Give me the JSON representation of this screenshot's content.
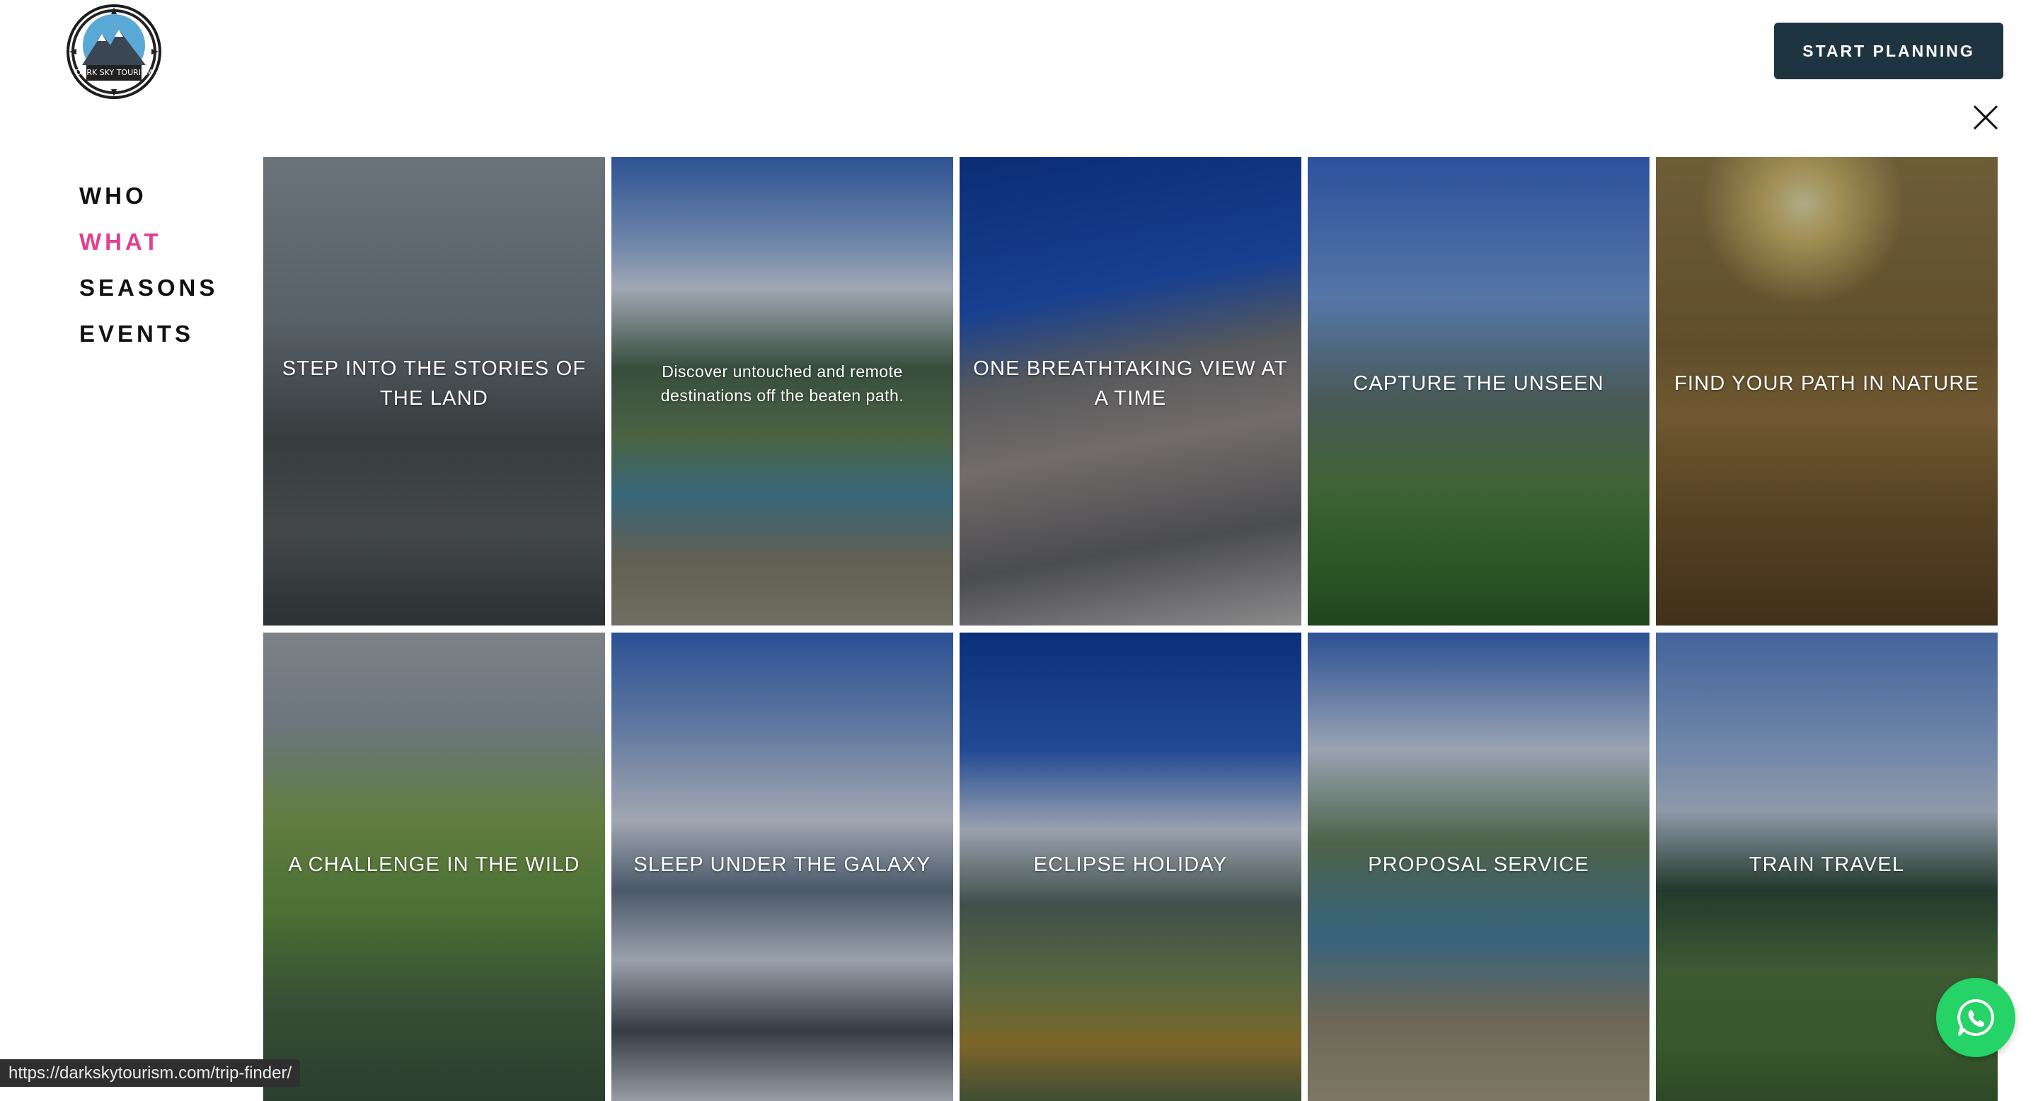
{
  "header": {
    "logo_text": "DARK SKY TOURISM",
    "cta_label": "START PLANNING"
  },
  "nav": {
    "items": [
      {
        "label": "WHO",
        "active": false
      },
      {
        "label": "WHAT",
        "active": true
      },
      {
        "label": "SEASONS",
        "active": false
      },
      {
        "label": "EVENTS",
        "active": false
      }
    ],
    "active_color": "#e33f8c"
  },
  "tiles": [
    {
      "label": "STEP INTO THE STORIES OF THE LAND"
    },
    {
      "label": "Discover untouched and remote destinations off the beaten path."
    },
    {
      "label": "ONE BREATHTAKING VIEW AT A TIME"
    },
    {
      "label": "CAPTURE THE UNSEEN"
    },
    {
      "label": "FIND YOUR PATH IN NATURE"
    },
    {
      "label": "A CHALLENGE IN THE WILD"
    },
    {
      "label": "SLEEP UNDER THE GALAXY"
    },
    {
      "label": "ECLIPSE HOLIDAY"
    },
    {
      "label": "PROPOSAL SERVICE"
    },
    {
      "label": "TRAIN TRAVEL"
    }
  ],
  "status_url": "https://darkskytourism.com/trip-finder/",
  "icons": {
    "close": "close-icon",
    "whatsapp": "whatsapp-icon",
    "logo": "mountain-compass-logo"
  },
  "colors": {
    "cta_bg": "#1f3441",
    "whatsapp": "#25d366"
  }
}
